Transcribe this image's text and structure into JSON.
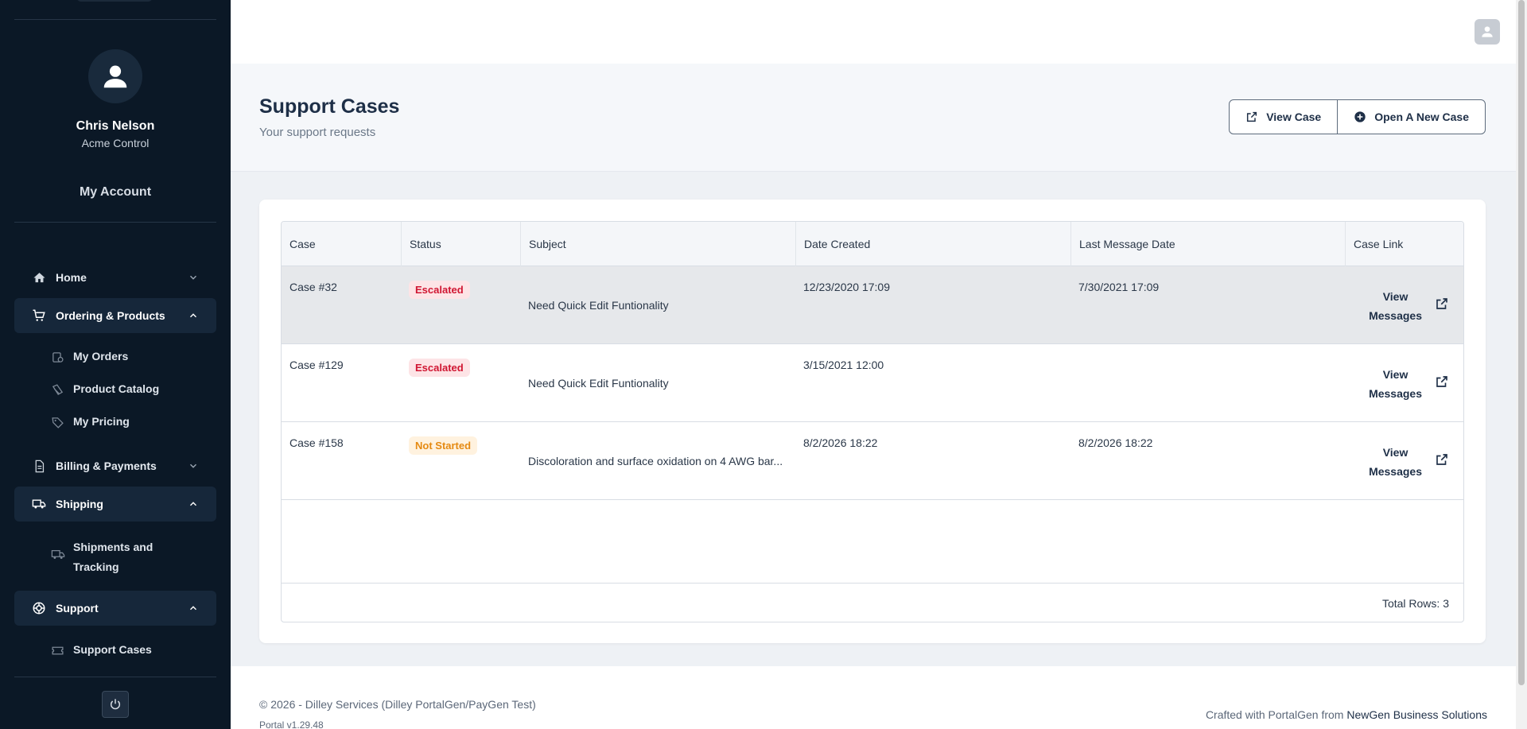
{
  "sidebar": {
    "user": {
      "name": "Chris Nelson",
      "org": "Acme Control"
    },
    "my_account": "My Account",
    "nav": [
      {
        "label": "Home",
        "icon": "home-icon",
        "expanded": false
      },
      {
        "label": "Ordering & Products",
        "icon": "cart-icon",
        "expanded": true,
        "children": [
          {
            "label": "My Orders",
            "icon": "orders-icon"
          },
          {
            "label": "Product Catalog",
            "icon": "catalog-icon"
          },
          {
            "label": "My Pricing",
            "icon": "tag-icon"
          }
        ]
      },
      {
        "label": "Billing & Payments",
        "icon": "document-icon",
        "expanded": false
      },
      {
        "label": "Shipping",
        "icon": "truck-icon",
        "expanded": true,
        "children": [
          {
            "label": "Shipments and Tracking",
            "icon": "truck-icon"
          }
        ]
      },
      {
        "label": "Support",
        "icon": "lifebuoy-icon",
        "expanded": true,
        "children": [
          {
            "label": "Support Cases",
            "icon": "ticket-icon"
          }
        ]
      }
    ]
  },
  "header": {
    "title": "Support Cases",
    "subtitle": "Your support requests",
    "view_case_label": "View Case",
    "open_case_label": "Open A New Case"
  },
  "table": {
    "columns": [
      "Case",
      "Status",
      "Subject",
      "Date Created",
      "Last Message Date",
      "Case Link"
    ],
    "rows": [
      {
        "case": "Case #32",
        "status": "Escalated",
        "status_kind": "escalated",
        "subject": "Need Quick Edit Funtionality",
        "created": "12/23/2020 17:09",
        "last_message": "7/30/2021 17:09",
        "link_line1": "View",
        "link_line2": "Messages"
      },
      {
        "case": "Case #129",
        "status": "Escalated",
        "status_kind": "escalated",
        "subject": "Need Quick Edit Funtionality",
        "created": "3/15/2021 12:00",
        "last_message": "",
        "link_line1": "View",
        "link_line2": "Messages"
      },
      {
        "case": "Case #158",
        "status": "Not Started",
        "status_kind": "not-started",
        "subject": "Discoloration and surface oxidation on 4 AWG bar...",
        "created": "8/2/2026 18:22",
        "last_message": "8/2/2026 18:22",
        "link_line1": "View",
        "link_line2": "Messages"
      }
    ],
    "total_rows": "Total Rows: 3"
  },
  "footer": {
    "copyright": "© 2026 - Dilley Services (Dilley PortalGen/PayGen Test)",
    "version": "Portal v1.29.48",
    "crafted_prefix": "Crafted with PortalGen from ",
    "crafted_brand": "NewGen Business Solutions"
  },
  "colors": {
    "sidebar_bg": "#0b1826",
    "escalated": "#d01632",
    "not_started": "#e58a12"
  }
}
